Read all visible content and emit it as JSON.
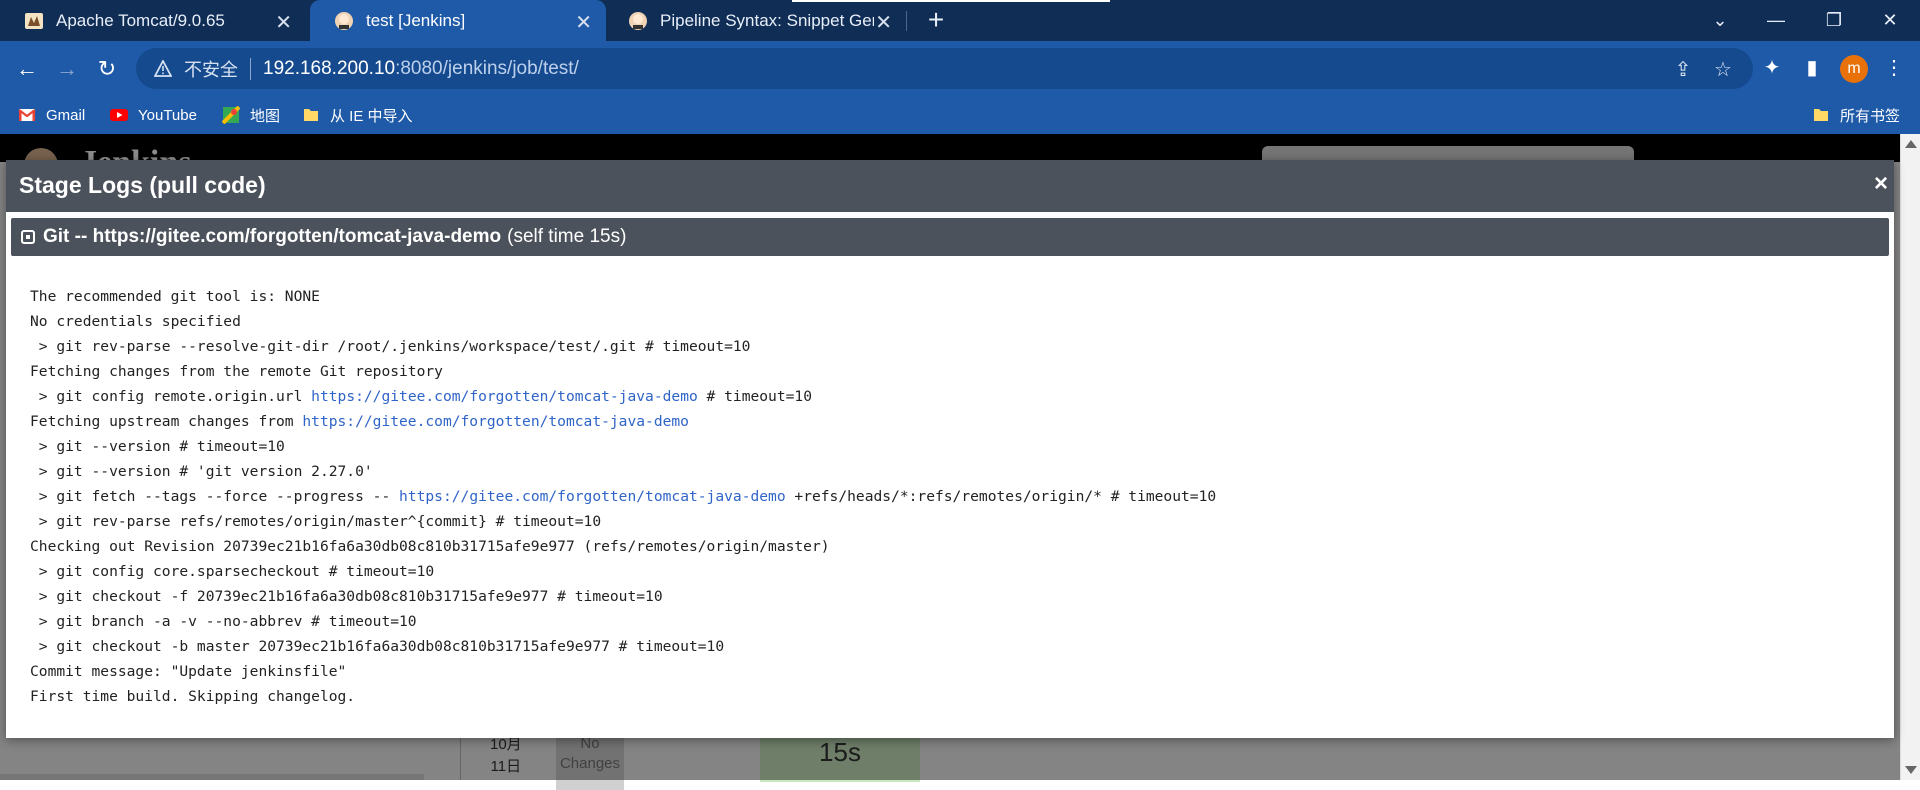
{
  "browser": {
    "tabs": [
      {
        "title": "Apache Tomcat/9.0.65",
        "icon": "tomcat-icon",
        "active": false
      },
      {
        "title": "test [Jenkins]",
        "icon": "jenkins-icon",
        "active": true
      },
      {
        "title": "Pipeline Syntax: Snippet Gene",
        "icon": "jenkins-icon",
        "active": false
      }
    ],
    "new_tab_label": "+",
    "window_buttons": {
      "tab_search": "⌄",
      "minimize": "—",
      "restore": "❐",
      "close": "✕"
    },
    "address": {
      "security_label": "不安全",
      "host": "192.168.200.10",
      "path": ":8080/jenkins/job/test/"
    },
    "avatar_letter": "m",
    "bookmarks": [
      {
        "label": "Gmail",
        "icon": "gmail-icon"
      },
      {
        "label": "YouTube",
        "icon": "youtube-icon"
      },
      {
        "label": "地图",
        "icon": "maps-icon"
      },
      {
        "label": "从 IE 中导入",
        "icon": "folder-icon"
      }
    ],
    "all_bookmarks_label": "所有书签"
  },
  "background_page": {
    "app_name": "Jenkins",
    "date_label": "10月\n11日",
    "no_changes_label": "No\nChanges",
    "stage_time": "15s"
  },
  "modal": {
    "title": "Stage Logs (pull code)",
    "close_label": "×",
    "step": {
      "name": "Git -- https://gitee.com/forgotten/tomcat-java-demo",
      "self_time": "(self time 15s)"
    },
    "log_lines": [
      [
        {
          "text": "The recommended git tool is: NONE"
        }
      ],
      [
        {
          "text": "No credentials specified"
        }
      ],
      [
        {
          "text": " > git rev-parse --resolve-git-dir /root/.jenkins/workspace/test/.git # timeout=10"
        }
      ],
      [
        {
          "text": "Fetching changes from the remote Git repository"
        }
      ],
      [
        {
          "text": " > git config remote.origin.url "
        },
        {
          "text": "https://gitee.com/forgotten/tomcat-java-demo",
          "link": true
        },
        {
          "text": " # timeout=10"
        }
      ],
      [
        {
          "text": "Fetching upstream changes from "
        },
        {
          "text": "https://gitee.com/forgotten/tomcat-java-demo",
          "link": true
        }
      ],
      [
        {
          "text": " > git --version # timeout=10"
        }
      ],
      [
        {
          "text": " > git --version # 'git version 2.27.0'"
        }
      ],
      [
        {
          "text": " > git fetch --tags --force --progress -- "
        },
        {
          "text": "https://gitee.com/forgotten/tomcat-java-demo",
          "link": true
        },
        {
          "text": " +refs/heads/*:refs/remotes/origin/* # timeout=10"
        }
      ],
      [
        {
          "text": " > git rev-parse refs/remotes/origin/master^{commit} # timeout=10"
        }
      ],
      [
        {
          "text": "Checking out Revision 20739ec21b16fa6a30db08c810b31715afe9e977 (refs/remotes/origin/master)"
        }
      ],
      [
        {
          "text": " > git config core.sparsecheckout # timeout=10"
        }
      ],
      [
        {
          "text": " > git checkout -f 20739ec21b16fa6a30db08c810b31715afe9e977 # timeout=10"
        }
      ],
      [
        {
          "text": " > git branch -a -v --no-abbrev # timeout=10"
        }
      ],
      [
        {
          "text": " > git checkout -b master 20739ec21b16fa6a30db08c810b31715afe9e977 # timeout=10"
        }
      ],
      [
        {
          "text": "Commit message: \"Update jenkinsfile\""
        }
      ],
      [
        {
          "text": "First time build. Skipping changelog."
        }
      ]
    ]
  },
  "colors": {
    "tabbar": "#0f2d55",
    "toolbar": "#1e5aa8",
    "modal_header": "#4c525b",
    "link": "#2f64c8",
    "avatar": "#e8710a"
  }
}
